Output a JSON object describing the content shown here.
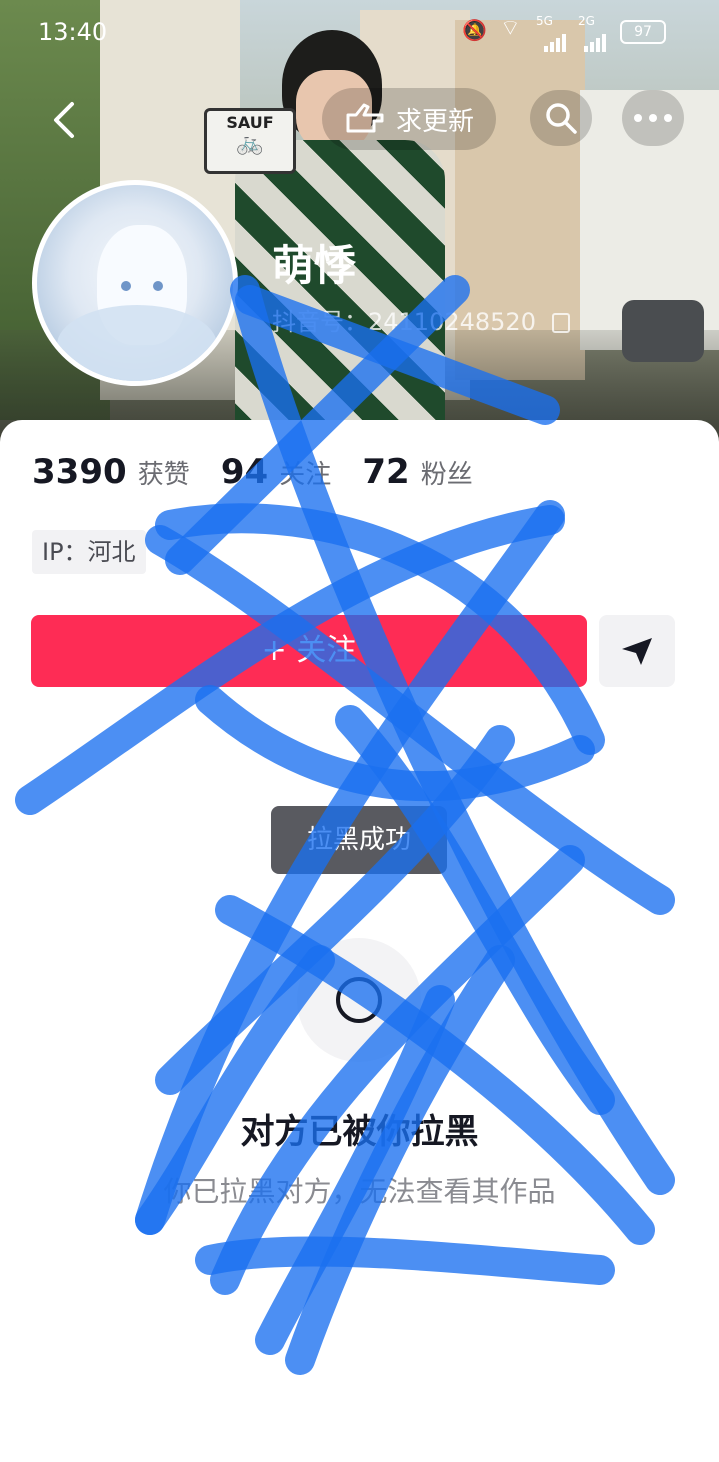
{
  "status_bar": {
    "time": "13:40",
    "network_1": "5G",
    "network_2": "2G",
    "battery": "97"
  },
  "top_bar": {
    "back_icon": "chevron-left-icon",
    "request_update_label": "求更新",
    "request_update_icon": "pointing-hand-icon",
    "search_icon": "search-icon",
    "more_icon": "more-dots-icon"
  },
  "cover": {
    "sign_text": "SAUF"
  },
  "profile": {
    "name": "萌悸",
    "douyin_id_label": "抖音号：",
    "douyin_id": "24110248520",
    "copy_icon": "copy-icon"
  },
  "stats": {
    "likes_value": "3390",
    "likes_label": "获赞",
    "following_value": "94",
    "following_label": "关注",
    "followers_value": "72",
    "followers_label": "粉丝"
  },
  "ip_tag": "IP：河北",
  "follow_button": {
    "label": "+ 关注"
  },
  "message_button": {
    "icon": "send-arrow-icon"
  },
  "toast": "拉黑成功",
  "blocked": {
    "title": "对方已被你拉黑",
    "subtitle": "你已拉黑对方，无法查看其作品"
  },
  "colors": {
    "follow_red": "#fe2c55",
    "overlay_blue": "#1a6ff0"
  }
}
